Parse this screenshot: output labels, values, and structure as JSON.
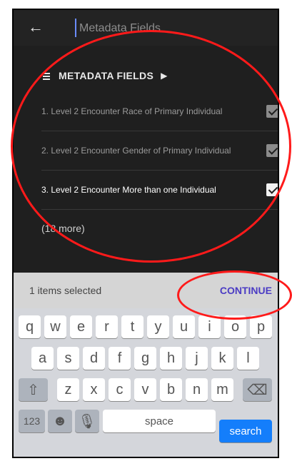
{
  "appbar": {
    "search_placeholder": "Metadata Fields"
  },
  "section": {
    "title": "METADATA FIELDS"
  },
  "list": {
    "items": [
      {
        "label": "1.  Level 2 Encounter Race of Primary Individual",
        "checked": true
      },
      {
        "label": "2.  Level 2 Encounter Gender of Primary Individual",
        "checked": true
      },
      {
        "label": "3.  Level 2 Encounter More than one Individual",
        "checked": true
      }
    ],
    "more_label": "(18 more)"
  },
  "selection": {
    "count_text": "1 items selected",
    "continue_label": "CONTINUE"
  },
  "keyboard": {
    "row1": [
      "q",
      "w",
      "e",
      "r",
      "t",
      "y",
      "u",
      "i",
      "o",
      "p"
    ],
    "row2": [
      "a",
      "s",
      "d",
      "f",
      "g",
      "h",
      "j",
      "k",
      "l"
    ],
    "row3": [
      "z",
      "x",
      "c",
      "v",
      "b",
      "n",
      "m"
    ],
    "bottom": {
      "numbers": "123",
      "space": "space",
      "search": "search"
    }
  }
}
